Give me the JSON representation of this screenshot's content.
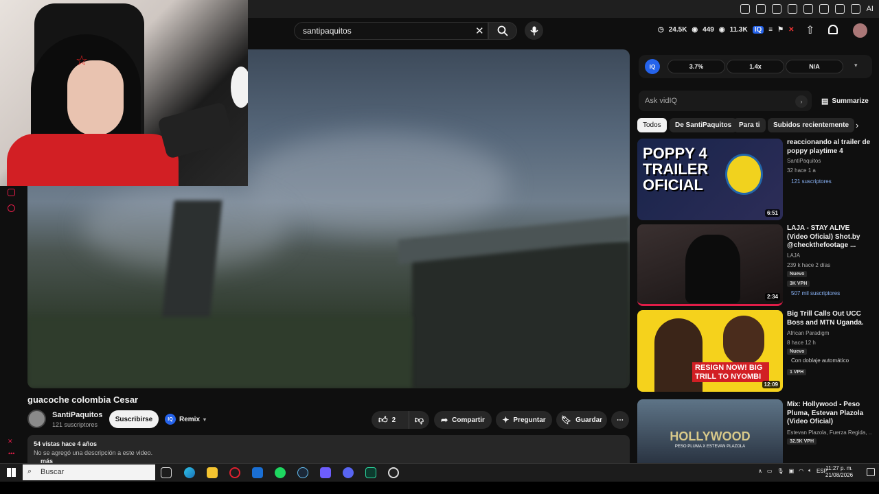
{
  "browser": {
    "ai_label": "AI"
  },
  "header": {
    "search_value": "santipaquitos",
    "stats": {
      "views_total": "24.5K",
      "views_eye": "449",
      "views_other": "11.3K"
    }
  },
  "video": {
    "title": "guacoche colombia Cesar",
    "channel": {
      "name": "SantiPaquitos",
      "subscribers": "121 suscriptores"
    },
    "subscribe_label": "Suscribirse",
    "remix_label": "Remix",
    "likes": "2",
    "share_label": "Compartir",
    "ask_label": "Preguntar",
    "save_label": "Guardar",
    "description": {
      "meta": "54 vistas  hace 4 años",
      "text": "No se agregó una descripción a este video.",
      "more": "más"
    }
  },
  "vidiq": {
    "logo": "IQ",
    "metrics": [
      "3.7%",
      "1.4x",
      "N/A"
    ],
    "ask_placeholder": "Ask vidIQ",
    "summarize_label": "Summarize"
  },
  "chips": [
    "Todos",
    "De SantiPaquitos",
    "Para ti",
    "Subidos recientemente"
  ],
  "recommendations": [
    {
      "title": "reaccionando al trailer de poppy playtime 4",
      "channel": "SantiPaquitos",
      "stats": "32  hace 1 a",
      "extra": "121 suscriptores",
      "duration": "6:51",
      "thumb_text": "POPPY 4 TRAILER OFICIAL",
      "thumb_color": "#1d2b4a"
    },
    {
      "title": "LAJA - STAY ALIVE (Video Oficial) Shot.by @checkthefootage ...",
      "channel": "LAJA",
      "stats": "239 k  hace 2 días",
      "badge1": "Nuevo",
      "badge2": "3K VPH",
      "extra": "507 mil suscriptores",
      "duration": "2:34",
      "thumb_color": "#2a2222"
    },
    {
      "title": "Big Trill Calls Out UCC Boss and MTN Uganda.",
      "channel": "African Paradigm",
      "stats": "8  hace 12 h",
      "badge1": "Nuevo",
      "extra": "Con doblaje automático",
      "badge2": "1 VPH",
      "duration": "12:09",
      "thumb_text": "RESIGN NOW! BIG TRILL TO NYOMBI",
      "thumb_color": "#f5d21c"
    },
    {
      "title": "Mix: Hollywood - Peso Pluma, Estevan Plazola (Video Oficial)",
      "channel": "Estevan Plazola, Fuerza Regida, ...",
      "badge2": "32.5K VPH",
      "thumb_text": "HOLLYWOOD",
      "thumb_sub": "PESO PLUMA X ESTEVAN PLAZOLA",
      "thumb_color": "#3a4a5c"
    }
  ],
  "taskbar": {
    "search_placeholder": "Buscar",
    "lang": "ESP",
    "time": "11:27 p. m.",
    "date": "21/08/2026"
  }
}
